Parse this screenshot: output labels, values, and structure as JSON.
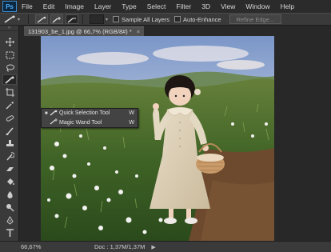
{
  "app": {
    "logo": "Ps"
  },
  "menu": [
    "File",
    "Edit",
    "Image",
    "Layer",
    "Type",
    "Select",
    "Filter",
    "3D",
    "View",
    "Window",
    "Help"
  ],
  "options": {
    "sample_all_layers": "Sample All Layers",
    "auto_enhance": "Auto-Enhance",
    "refine_edge": "Refine Edge..."
  },
  "document": {
    "tab_title": "131903_be_1.jpg @ 66,7% (RGB/8#) *",
    "close": "×"
  },
  "flyout": {
    "items": [
      {
        "label": "Quick Selection Tool",
        "key": "W",
        "icon": "quick-selection-icon",
        "active": true
      },
      {
        "label": "Magic Wand Tool",
        "key": "W",
        "icon": "magic-wand-icon",
        "active": false
      }
    ]
  },
  "status": {
    "zoom": "66,67%",
    "doc": "Doc : 1,37M/1,37M"
  },
  "colors": {
    "accent": "#31a8ff",
    "panel": "#3a3a3a",
    "bg": "#282828"
  }
}
